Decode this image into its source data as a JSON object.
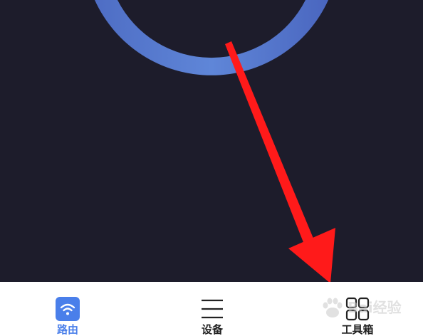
{
  "tabbar": {
    "tabs": [
      {
        "label": "路由",
        "icon": "wifi-icon",
        "active": true
      },
      {
        "label": "设备",
        "icon": "menu-icon",
        "active": false
      },
      {
        "label": "工具箱",
        "icon": "grid-icon",
        "active": false
      }
    ]
  },
  "watermark": {
    "text": "Bai经验"
  },
  "colors": {
    "background": "#1d1c2b",
    "ring_accent": "#5b7fd0",
    "arrow": "#ff1a1a",
    "active_tab": "#4a7fea"
  }
}
